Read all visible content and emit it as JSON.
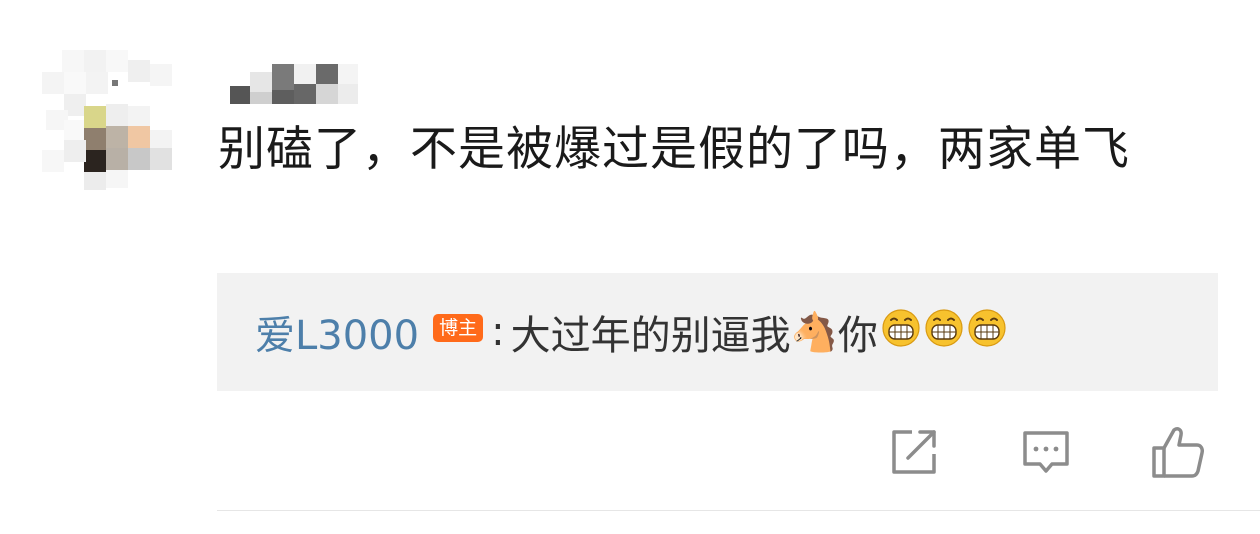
{
  "comment": {
    "text": "别磕了，不是被爆过是假的了吗，两家单飞"
  },
  "reply": {
    "author": "爱L3000",
    "badge": "博主",
    "colon": ":",
    "text": "大过年的别逼我",
    "horse_emoji": "🐴",
    "text_after": "你",
    "grin_emoji_count": 3
  },
  "actions": {
    "share_icon": "share-icon",
    "comment_icon": "comment-icon",
    "like_icon": "like-icon"
  },
  "colors": {
    "author_link": "#4d7faa",
    "badge_bg": "#ff6a1a",
    "reply_bg": "#f2f2f2",
    "icon_gray": "#8c8c8c"
  }
}
